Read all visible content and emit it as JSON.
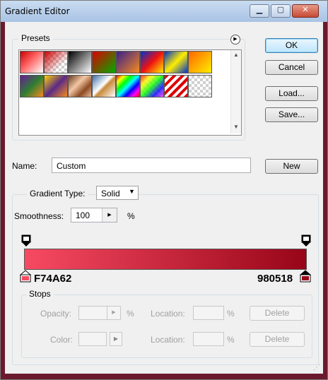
{
  "window": {
    "title": "Gradient Editor"
  },
  "presets": {
    "label": "Presets",
    "swatches_row1": [
      "red-transparent",
      "red-checker",
      "black-white",
      "red-green",
      "violet-orange",
      "blue-red-yellow",
      "blue-yellow-blue",
      "orange-yellow"
    ],
    "swatches_row2": [
      "violet-green-orange",
      "yellow-violet-orange",
      "copper",
      "chrome",
      "spectrum",
      "transparent-rainbow",
      "transparent-stripes",
      "transparent-checker"
    ]
  },
  "buttons": {
    "ok": "OK",
    "cancel": "Cancel",
    "load": "Load...",
    "save": "Save...",
    "new": "New"
  },
  "name": {
    "label": "Name:",
    "value": "Custom"
  },
  "gradient": {
    "type_label": "Gradient Type:",
    "type_value": "Solid",
    "smoothness_label": "Smoothness:",
    "smoothness_value": "100",
    "smoothness_unit": "%",
    "start_color": "#F74A62",
    "end_color": "#980518",
    "start_label": "F74A62",
    "end_label": "980518"
  },
  "stops": {
    "label": "Stops",
    "opacity_label": "Opacity:",
    "opacity_unit": "%",
    "location_label": "Location:",
    "location_unit": "%",
    "delete_label": "Delete",
    "color_label": "Color:"
  }
}
